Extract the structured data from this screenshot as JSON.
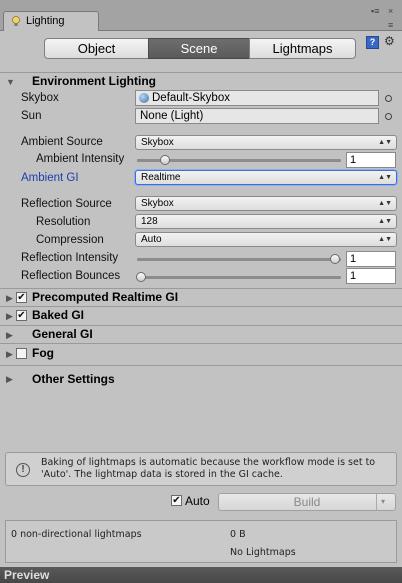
{
  "window": {
    "tab_title": "Lighting",
    "menu_glyph": "▪≡",
    "close_glyph": "×",
    "menu_glyph2": "≡"
  },
  "toolbar": {
    "object_label": "Object",
    "scene_label": "Scene",
    "lightmaps_label": "Lightmaps",
    "help_glyph": "?",
    "gear_glyph": "⚙"
  },
  "environment": {
    "title": "Environment Lighting",
    "skybox_label": "Skybox",
    "skybox_value": "Default-Skybox",
    "sun_label": "Sun",
    "sun_value": "None (Light)",
    "ambient_source_label": "Ambient Source",
    "ambient_source_value": "Skybox",
    "ambient_intensity_label": "Ambient Intensity",
    "ambient_intensity_value": "1",
    "ambient_intensity_fraction": 0.125,
    "ambient_gi_label": "Ambient GI",
    "ambient_gi_value": "Realtime",
    "reflection_source_label": "Reflection Source",
    "reflection_source_value": "Skybox",
    "resolution_label": "Resolution",
    "resolution_value": "128",
    "compression_label": "Compression",
    "compression_value": "Auto",
    "reflection_intensity_label": "Reflection Intensity",
    "reflection_intensity_value": "1",
    "reflection_intensity_fraction": 1.0,
    "reflection_bounces_label": "Reflection Bounces",
    "reflection_bounces_value": "1",
    "reflection_bounces_fraction": 0.0
  },
  "sections": {
    "precomputed_gi": "Precomputed Realtime GI",
    "precomputed_gi_checked": true,
    "baked_gi": "Baked GI",
    "baked_gi_checked": true,
    "general_gi": "General GI",
    "fog": "Fog",
    "fog_checked": false,
    "other_settings": "Other Settings"
  },
  "help": {
    "icon": "!",
    "text": "Baking of lightmaps is automatic because the workflow mode is set to 'Auto'. The lightmap data is stored in the GI cache."
  },
  "build": {
    "auto_label": "Auto",
    "auto_checked": true,
    "build_label": "Build",
    "arrow": "▾"
  },
  "stats": {
    "lightmaps_text": "0 non-directional lightmaps",
    "size_text": "0 B",
    "no_lightmaps_text": "No Lightmaps"
  },
  "preview": {
    "label": "Preview"
  },
  "colors": {
    "panel_bg": "#c2c2c2",
    "active_segment": "#5f5f5f",
    "ambient_gi_label": "#1b3fae",
    "focus_border": "#3a6fd8"
  }
}
